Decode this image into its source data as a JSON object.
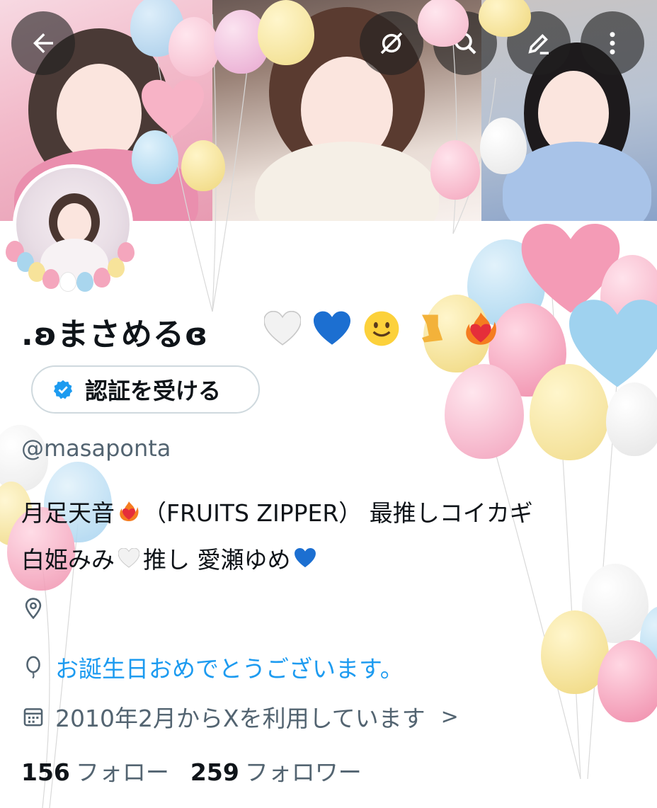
{
  "header": {
    "back_icon": "arrow-left-icon",
    "actions": [
      "translate-off-icon",
      "search-icon",
      "edit-icon",
      "more-vertical-icon"
    ]
  },
  "profile": {
    "display_name": ".ʚまさめるɞ",
    "name_emojis": [
      "white-heart-emoji",
      "blue-heart-emoji",
      "smiling-face-emoji",
      "leg-emoji",
      "heart-on-fire-emoji"
    ],
    "verify_button": "認証を受ける",
    "handle": "@masaponta",
    "bio_line1_a": "月足天音",
    "bio_line1_b": "（FRUITS ZIPPER） 最推しコイカギ",
    "bio_line2_a": "白姫みみ",
    "bio_line2_b": "推し 愛瀬ゆめ",
    "birthday_text": "お誕生日おめでとうございます。",
    "joined_text": "2010年2月からXを利用しています",
    "joined_chevron": ">"
  },
  "stats": {
    "following_count": "156",
    "following_label": "フォロー",
    "followers_count": "259",
    "followers_label": "フォロワー"
  },
  "colors": {
    "accent": "#1d9bf0",
    "secondary_text": "#536471",
    "primary_text": "#0f1419",
    "balloon_pink": "#f4a6bd",
    "balloon_blue": "#a9d6ee",
    "balloon_yellow": "#f7e39a"
  }
}
